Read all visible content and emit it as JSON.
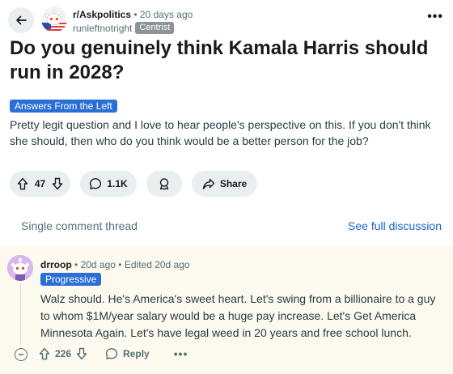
{
  "post": {
    "subreddit": "r/Askpolitics",
    "time_ago": "20 days ago",
    "author": "runleftnotright",
    "author_flair": "Centrist",
    "title": "Do you genuinely think Kamala Harris should run in 2028?",
    "flair": "Answers From the Left",
    "body": "Pretty legit question and I love to hear people's perspective on this. If you don't think she should, then who do you think would be a better person for the job?",
    "votes": "47",
    "comments": "1.1K",
    "share_label": "Share"
  },
  "thread": {
    "label": "Single comment thread",
    "see_full": "See full discussion"
  },
  "comment": {
    "author": "drroop",
    "time_ago": "20d ago",
    "edited": "Edited 20d ago",
    "flair": "Progressive",
    "text": "Walz should. He's America's sweet heart. Let's swing from a billionaire to a guy to whom $1M/year salary would be a huge pay increase. Let's Get America Minnesota Again. Let's have legal weed in 20 years and free school lunch.",
    "votes": "226",
    "reply_label": "Reply"
  },
  "colors": {
    "accent_blue": "#2a6fd6",
    "link_blue": "#1d63c9",
    "pill_bg": "#e9eef1",
    "comment_bg": "#fcf9ee"
  }
}
